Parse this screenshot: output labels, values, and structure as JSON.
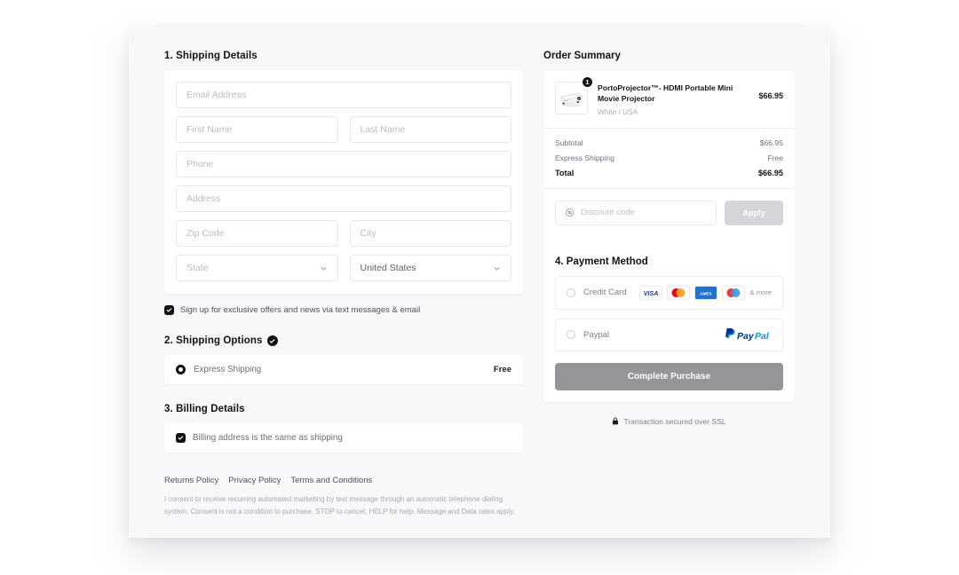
{
  "shipping": {
    "section_title": "1. Shipping Details",
    "fields": {
      "email_placeholder": "Email Address",
      "first_name_placeholder": "First Name",
      "last_name_placeholder": "Last Name",
      "phone_placeholder": "Phone",
      "address_placeholder": "Address",
      "zip_placeholder": "Zip Code",
      "city_placeholder": "City",
      "state_placeholder": "State",
      "country_value": "United States"
    },
    "optin_label": "Sign up for exclusive offers and news via text messages & email"
  },
  "shipping_options": {
    "section_title": "2. Shipping Options",
    "option_label": "Express Shipping",
    "option_price": "Free"
  },
  "billing": {
    "section_title": "3. Billing Details",
    "same_as_shipping_label": "Billing address is the same as shipping"
  },
  "legal": {
    "links": [
      "Returns Policy",
      "Privacy Policy",
      "Terms and Conditions"
    ],
    "consent_text": "I consent to receive recurring automated marketing by text message through an automatic telephone dialing system. Consent is not a condition to purchase. STOP to cancel, HELP for help. Message and Data rates apply."
  },
  "order_summary": {
    "title": "Order Summary",
    "product": {
      "name": "PortoProjector™- HDMI Portable Mini Movie Projector",
      "variant": "White / USA",
      "price": "$66.95",
      "quantity_badge": "1"
    },
    "totals": [
      {
        "label": "Subtotal",
        "value": "$66.95"
      },
      {
        "label": "Express Shipping",
        "value": "Free"
      }
    ],
    "grand_total": {
      "label": "Total",
      "value": "$66.95"
    },
    "discount": {
      "placeholder": "Discount code",
      "apply_label": "Apply"
    }
  },
  "payment": {
    "section_title": "4. Payment Method",
    "methods": [
      {
        "label": "Credit Card",
        "more_label": "& more"
      },
      {
        "label": "Paypal"
      }
    ],
    "card_brands": [
      "VISA",
      "Mastercard",
      "AMEX",
      "Maestro"
    ],
    "cta_label": "Complete Purchase",
    "ssl_text": "Transaction secured over SSL"
  },
  "colors": {
    "page_bg": "#ffffff",
    "card_bg": "#f7f8fa",
    "accent_dark": "#111114",
    "cta_disabled": "#949499",
    "apply_disabled": "#d4d5d8",
    "placeholder": "#b8bcc4"
  }
}
